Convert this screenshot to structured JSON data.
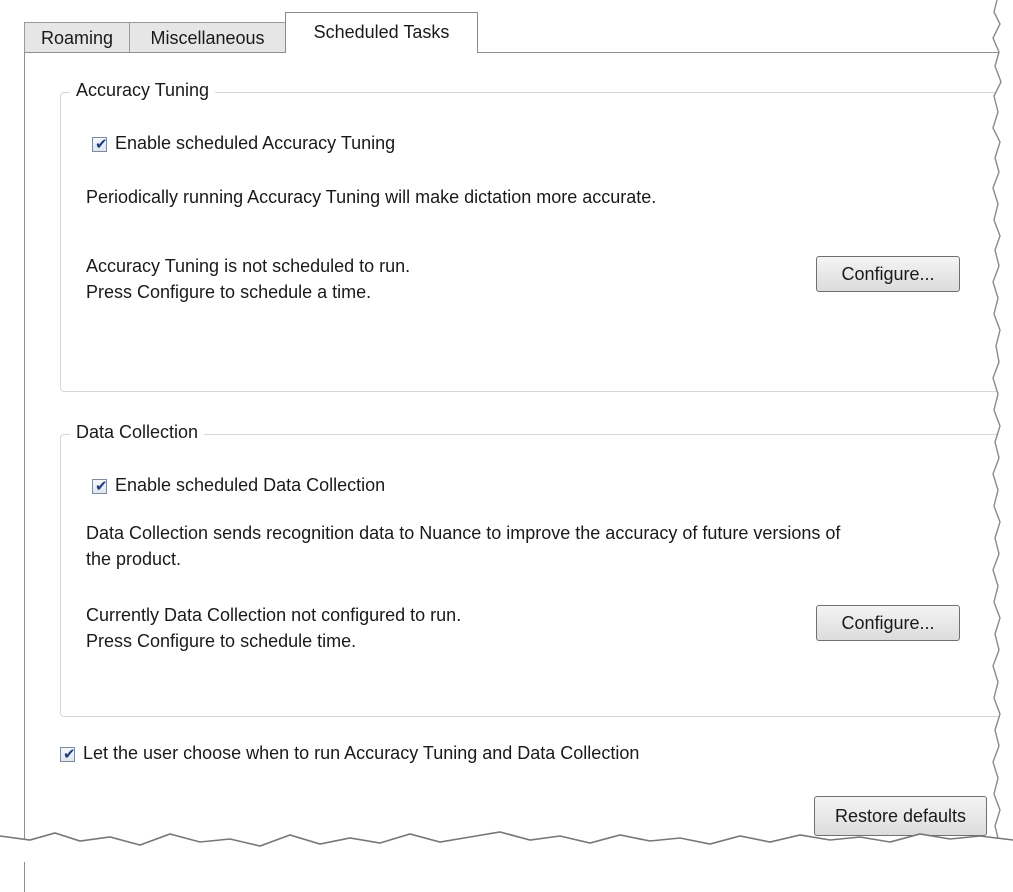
{
  "tabs": [
    {
      "label": "Roaming"
    },
    {
      "label": "Miscellaneous"
    },
    {
      "label": "Scheduled Tasks",
      "selected": true
    }
  ],
  "accuracy_tuning": {
    "title": "Accuracy Tuning",
    "enable_label": "Enable scheduled Accuracy Tuning",
    "enable_checked": true,
    "description": "Periodically running Accuracy Tuning will make dictation more accurate.",
    "status_line1": "Accuracy Tuning is not scheduled to run.",
    "status_line2": "Press Configure to schedule a time.",
    "configure_label": "Configure..."
  },
  "data_collection": {
    "title": "Data Collection",
    "enable_label": "Enable scheduled Data Collection",
    "enable_checked": true,
    "description_line1": "Data Collection sends recognition data to Nuance to improve the accuracy of future versions of",
    "description_line2": "the product.",
    "status_line1": "Currently Data Collection not configured to run.",
    "status_line2": "Press Configure to schedule time.",
    "configure_label": "Configure..."
  },
  "user_choose": {
    "label": "Let the user choose when to run Accuracy Tuning and Data Collection",
    "checked": true
  },
  "restore_label": "Restore defaults"
}
